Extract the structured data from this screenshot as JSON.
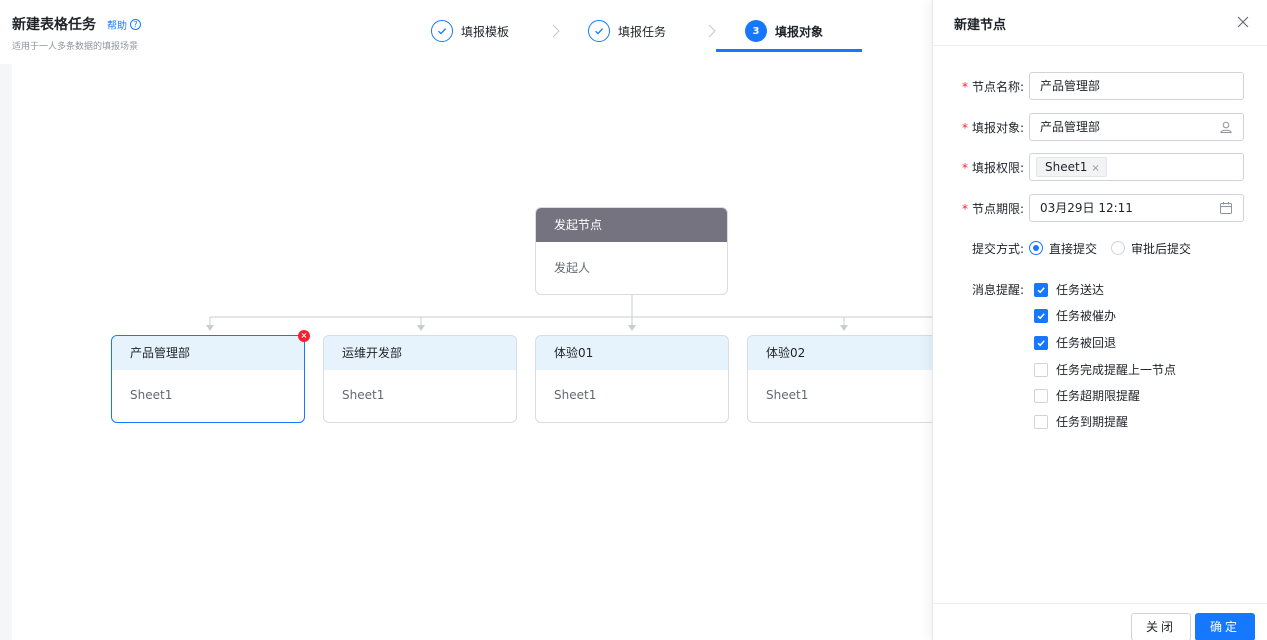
{
  "header": {
    "title": "新建表格任务",
    "help_label": "帮助",
    "help_icon_glyph": "?",
    "subtitle": "适用于一人多条数据的填报场景"
  },
  "steps": [
    {
      "label": "填报模板",
      "state": "done"
    },
    {
      "label": "填报任务",
      "state": "done"
    },
    {
      "label": "填报对象",
      "state": "active",
      "number": "3"
    }
  ],
  "flow": {
    "start_node": {
      "title": "发起节点",
      "body": "发起人"
    },
    "child_nodes": [
      {
        "title": "产品管理部",
        "body": "Sheet1",
        "selected": true,
        "delete_glyph": "×"
      },
      {
        "title": "运维开发部",
        "body": "Sheet1"
      },
      {
        "title": "体验01",
        "body": "Sheet1"
      },
      {
        "title": "体验02",
        "body": "Sheet1"
      }
    ]
  },
  "drawer": {
    "title": "新建节点",
    "required_mark": "*",
    "fields": {
      "node_name": {
        "label": "节点名称:",
        "value": "产品管理部"
      },
      "fill_target": {
        "label": "填报对象:",
        "value": "产品管理部"
      },
      "permission": {
        "label": "填报权限:",
        "tag": "Sheet1",
        "tag_close": "×"
      },
      "deadline": {
        "label": "节点期限:",
        "value": "03月29日 12:11"
      },
      "submit_mode": {
        "label": "提交方式:",
        "options": [
          {
            "label": "直接提交",
            "checked": true
          },
          {
            "label": "审批后提交",
            "checked": false
          }
        ]
      },
      "reminders": {
        "label": "消息提醒:",
        "options": [
          {
            "label": "任务送达",
            "checked": true
          },
          {
            "label": "任务被催办",
            "checked": true
          },
          {
            "label": "任务被回退",
            "checked": true
          },
          {
            "label": "任务完成提醒上一节点",
            "checked": false
          },
          {
            "label": "任务超期限提醒",
            "checked": false
          },
          {
            "label": "任务到期提醒",
            "checked": false
          }
        ]
      }
    },
    "footer": {
      "cancel_label": "关闭",
      "ok_label": "确定"
    }
  },
  "colors": {
    "accent": "#1677ff",
    "start_node_header": "#75737f",
    "child_node_header": "#e6f3fd",
    "danger": "#f5222d"
  }
}
